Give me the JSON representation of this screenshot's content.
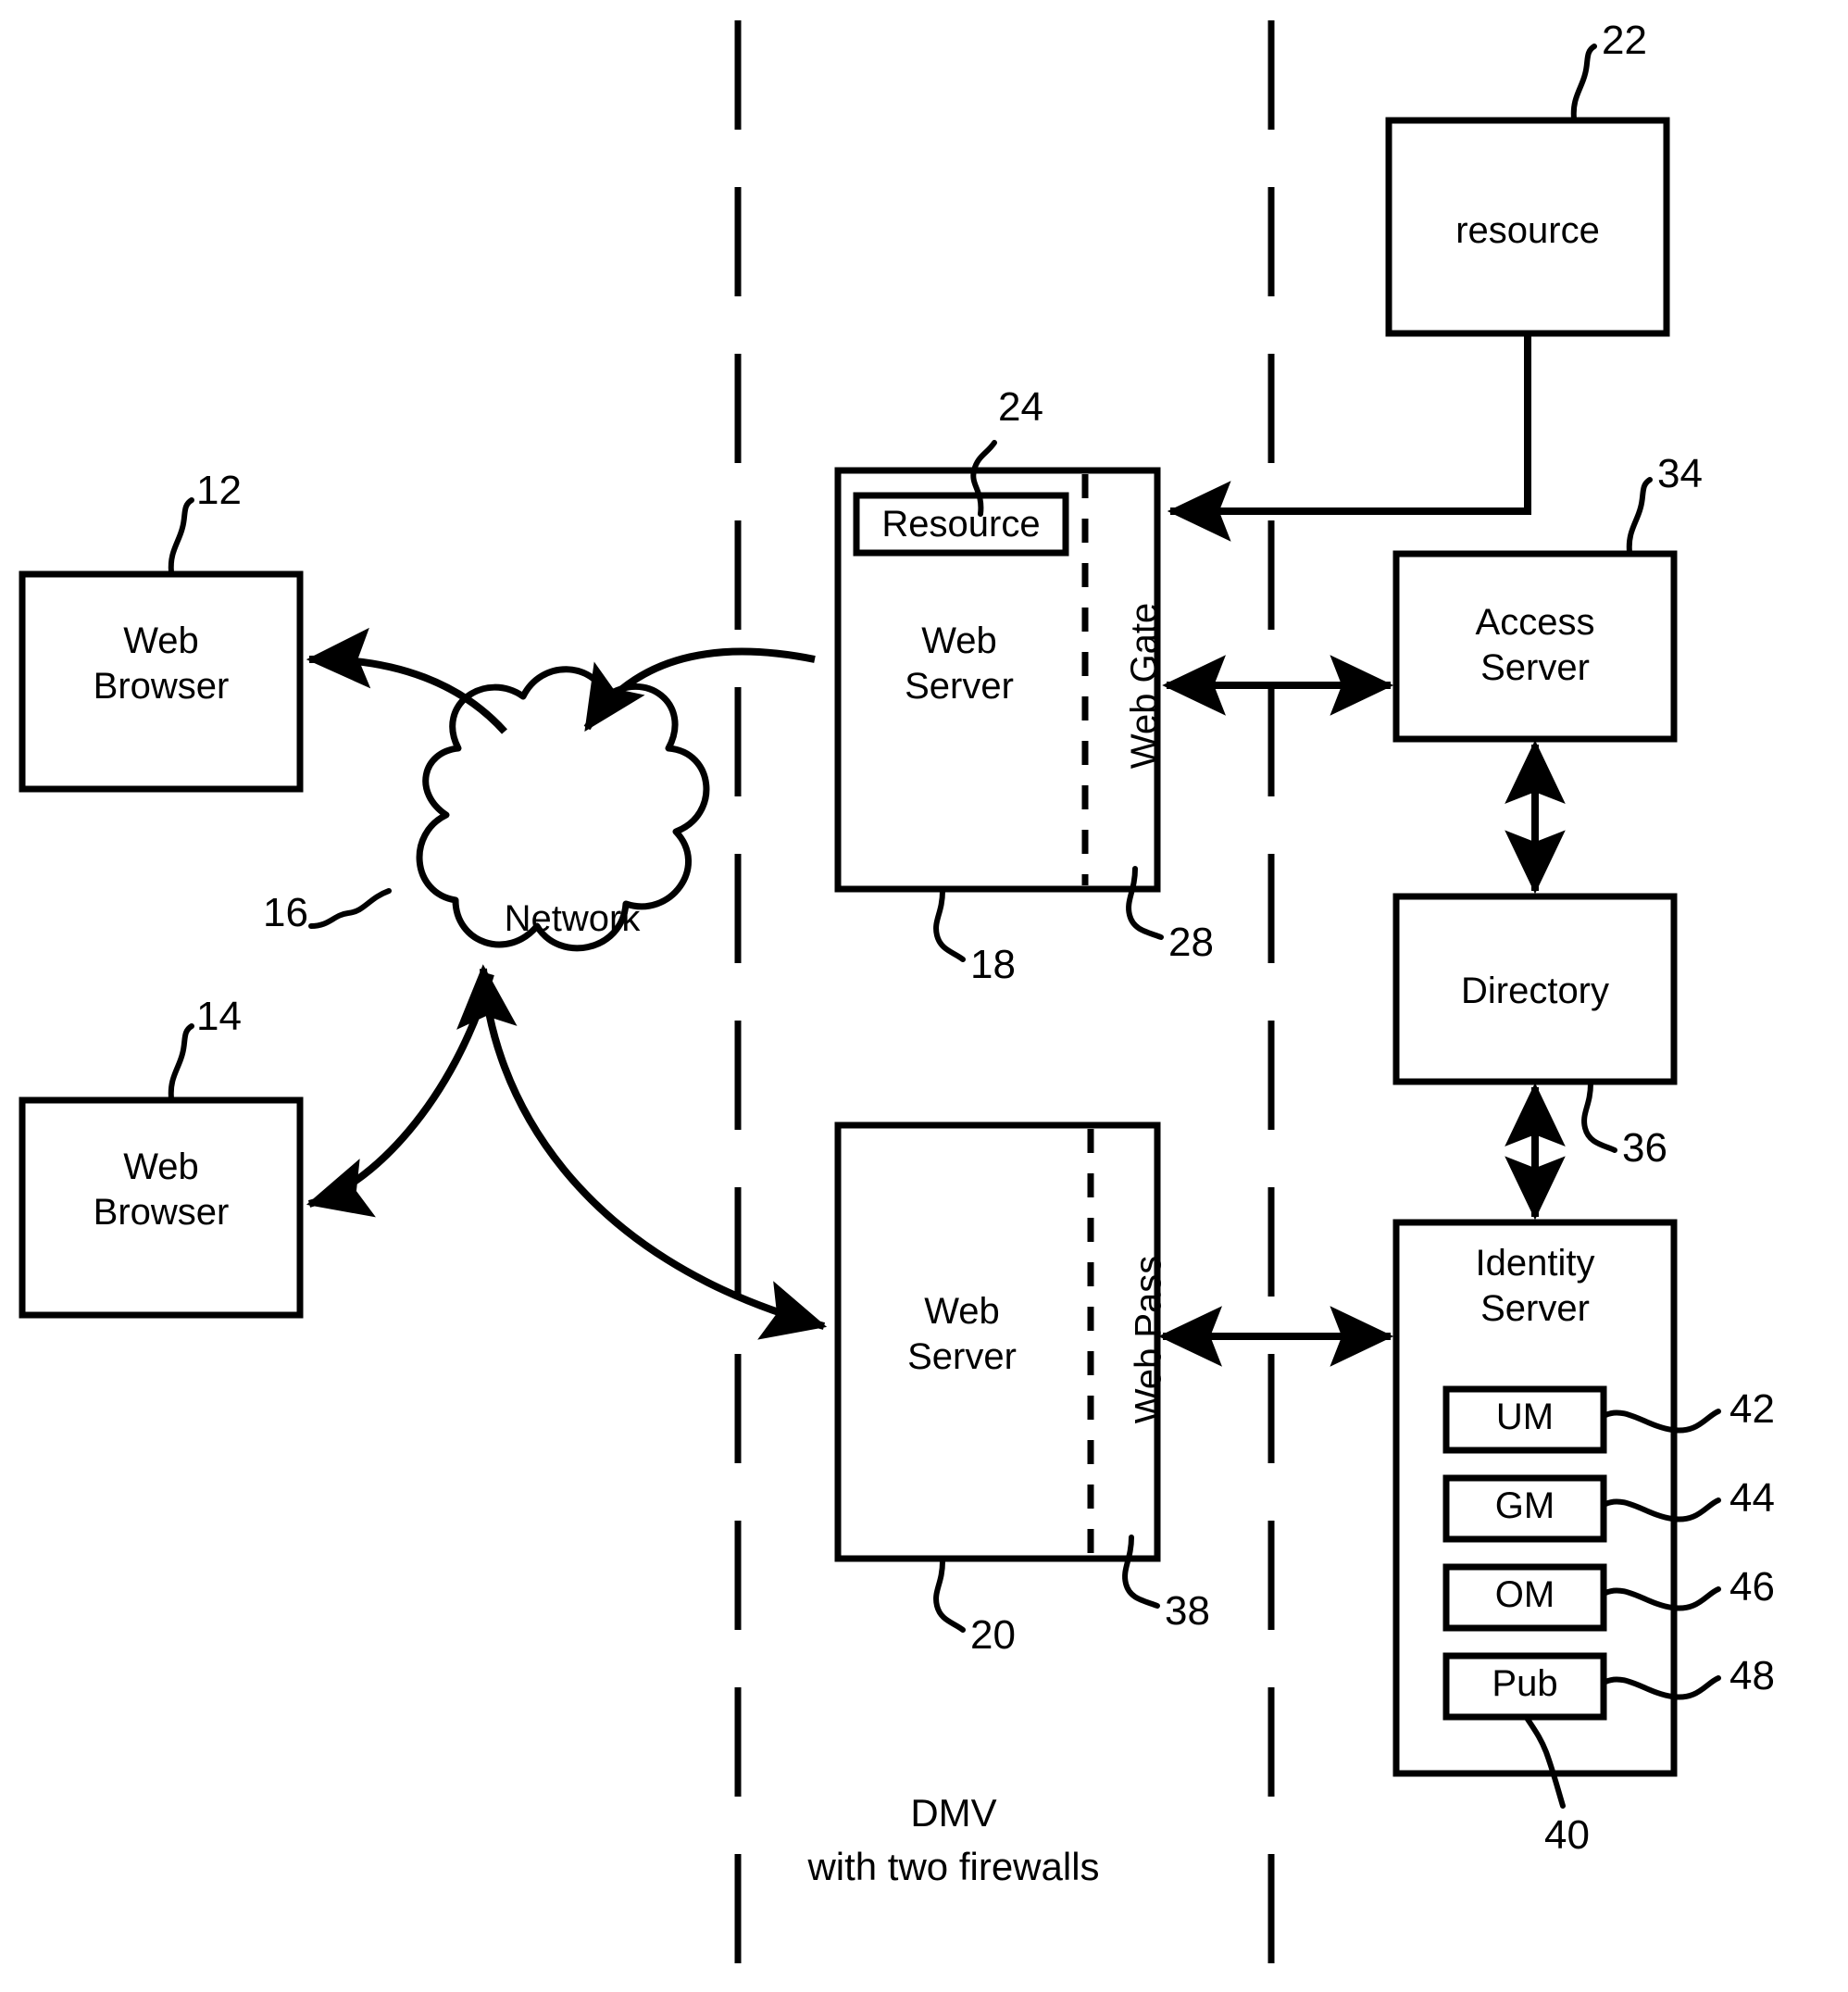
{
  "figure": {
    "caption_line1": "DMV",
    "caption_line2": "with  two firewalls"
  },
  "nodes": {
    "web_browser_top": {
      "label": "Web\nBrowser",
      "ref": "12"
    },
    "web_browser_bottom": {
      "label": "Web\nBrowser",
      "ref": "14"
    },
    "network": {
      "label": "Network",
      "ref": "16"
    },
    "web_server_top": {
      "label": "Web\nServer",
      "ref": "18"
    },
    "web_gate": {
      "label": "Web Gate",
      "ref": "28"
    },
    "resource_inner": {
      "label": "Resource",
      "ref": "24"
    },
    "resource_external": {
      "label": "resource",
      "ref": "22"
    },
    "access_server": {
      "label": "Access\nServer",
      "ref": "34"
    },
    "directory": {
      "label": "Directory",
      "ref": "36"
    },
    "identity_server": {
      "label": "Identity\nServer",
      "ref": "40"
    },
    "web_server_bottom": {
      "label": "Web\nServer",
      "ref": "20"
    },
    "web_pass": {
      "label": "Web Pass",
      "ref": "38"
    },
    "um": {
      "label": "UM",
      "ref": "42"
    },
    "gm": {
      "label": "GM",
      "ref": "44"
    },
    "om": {
      "label": "OM",
      "ref": "46"
    },
    "pub": {
      "label": "Pub",
      "ref": "48"
    }
  },
  "colors": {
    "stroke": "#000000",
    "background": "#ffffff"
  }
}
